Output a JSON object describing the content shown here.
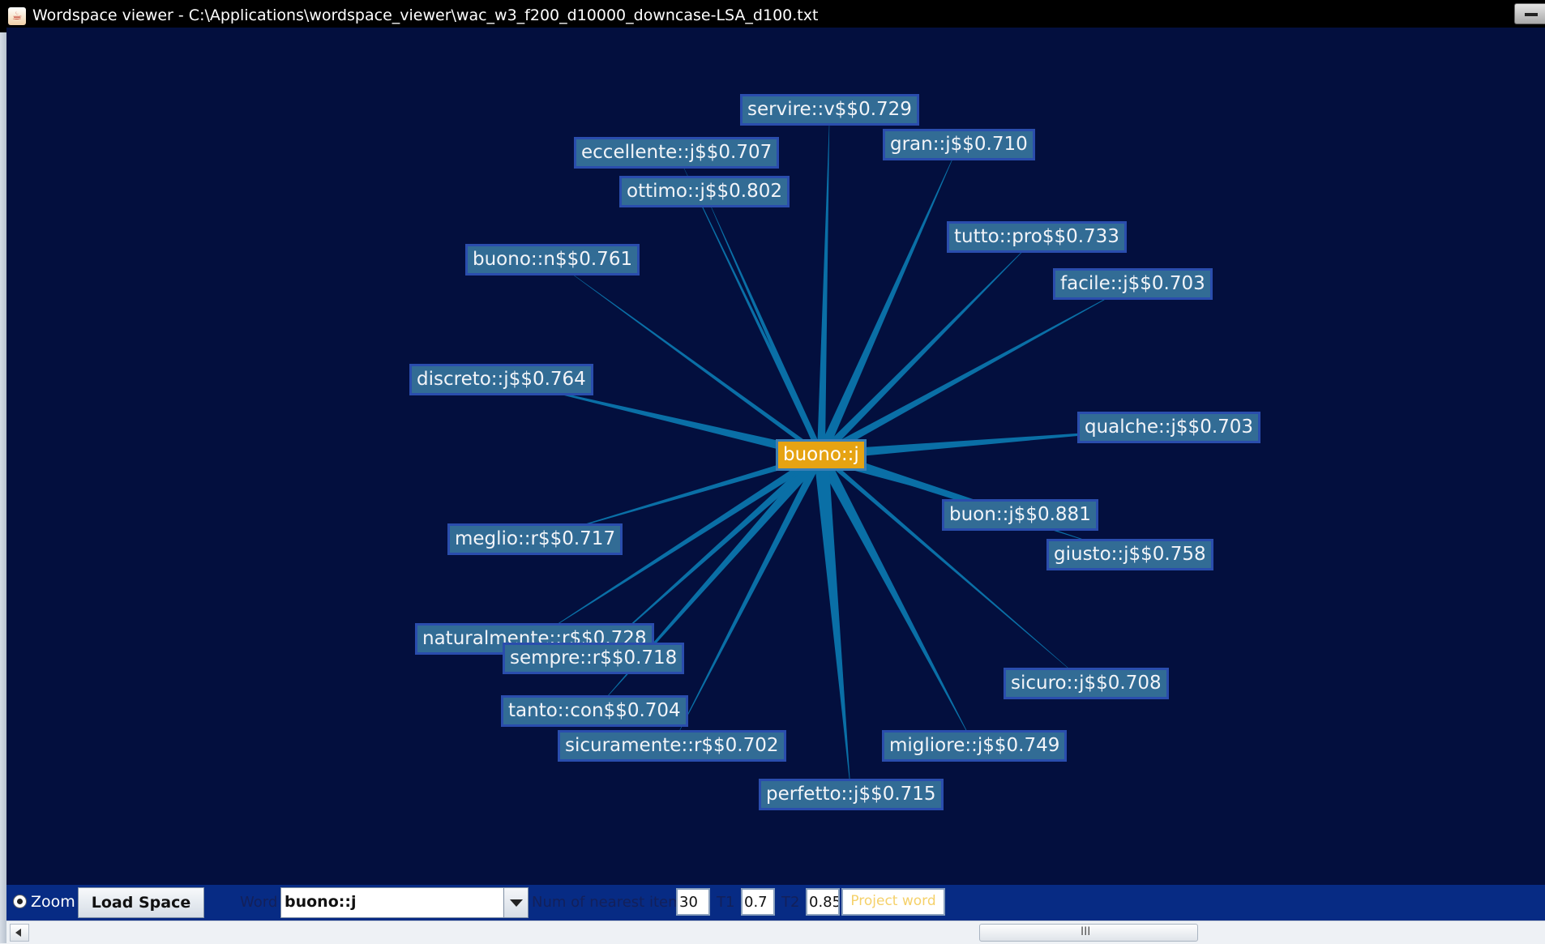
{
  "window": {
    "title": "Wordspace viewer - C:\\Applications\\wordspace_viewer\\wac_w3_f200_d10000_downcase-LSA_d100.txt",
    "icon": "java-cup-icon"
  },
  "graph": {
    "center": {
      "label": "buono::j",
      "color": "#e6a312"
    },
    "node_color": "#326c95",
    "edge_color": "#0a6fa6",
    "background": "#030f3e",
    "nodes": [
      {
        "label": "servire::v$$0.729"
      },
      {
        "label": "gran::j$$0.710"
      },
      {
        "label": "eccellente::j$$0.707"
      },
      {
        "label": "ottimo::j$$0.802"
      },
      {
        "label": "tutto::pro$$0.733"
      },
      {
        "label": "buono::n$$0.761"
      },
      {
        "label": "facile::j$$0.703"
      },
      {
        "label": "discreto::j$$0.764"
      },
      {
        "label": "qualche::j$$0.703"
      },
      {
        "label": "buon::j$$0.881"
      },
      {
        "label": "giusto::j$$0.758"
      },
      {
        "label": "meglio::r$$0.717"
      },
      {
        "label": "naturalmente::r$$0.728"
      },
      {
        "label": "sempre::r$$0.718"
      },
      {
        "label": "sicuro::j$$0.708"
      },
      {
        "label": "tanto::con$$0.704"
      },
      {
        "label": "sicuramente::r$$0.702"
      },
      {
        "label": "migliore::j$$0.749"
      },
      {
        "label": "perfetto::j$$0.715"
      }
    ]
  },
  "toolbar": {
    "zoom_label": "Zoom",
    "load_space_label": "Load Space",
    "word_label": "Word",
    "word_value": "buono::j",
    "num_nearest_label": "Num of nearest item",
    "num_nearest_value": "30",
    "t1_label": "T1",
    "t1_value": "0.7",
    "t2_label": "T2",
    "t2_value": "0.85",
    "project_word_label": "Project word"
  },
  "scrollbar": {
    "grip": "III"
  }
}
